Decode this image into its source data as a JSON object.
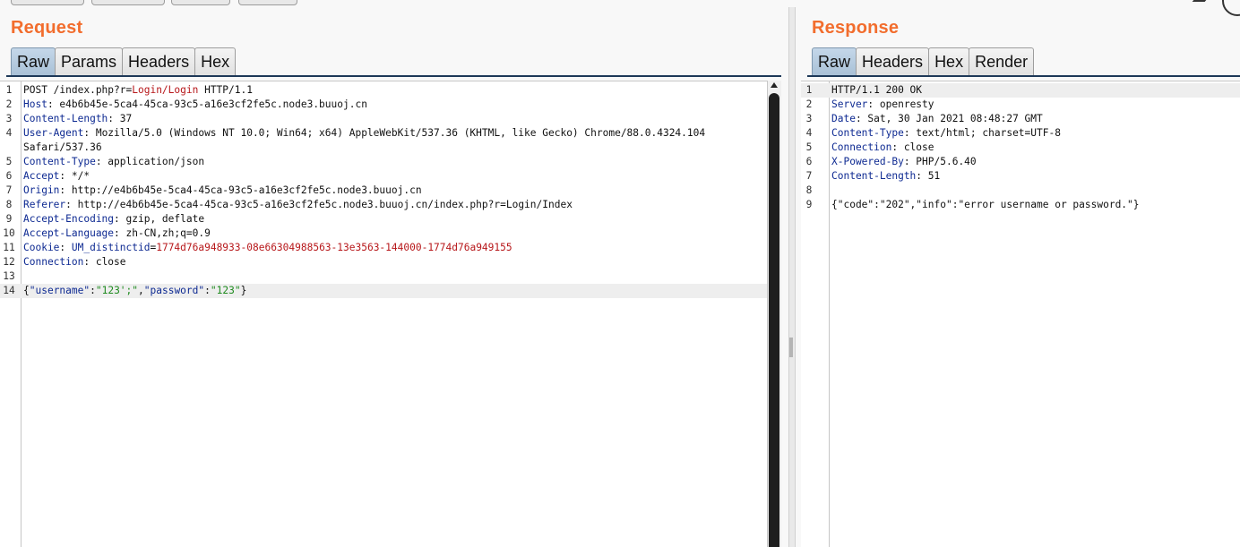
{
  "request": {
    "title": "Request",
    "tabs": [
      {
        "label": "Raw",
        "active": true
      },
      {
        "label": "Params",
        "active": false
      },
      {
        "label": "Headers",
        "active": false
      },
      {
        "label": "Hex",
        "active": false
      }
    ],
    "lines": [
      {
        "n": "1",
        "parts": [
          {
            "t": "POST /index.php?r="
          },
          {
            "t": "Login/Login",
            "c": "red"
          },
          {
            "t": " HTTP/1.1"
          }
        ]
      },
      {
        "n": "2",
        "parts": [
          {
            "t": "Host",
            "c": "hn"
          },
          {
            "t": ": e4b6b45e-5ca4-45ca-93c5-a16e3cf2fe5c.node3.buuoj.cn"
          }
        ]
      },
      {
        "n": "3",
        "parts": [
          {
            "t": "Content-Length",
            "c": "hn"
          },
          {
            "t": ": 37"
          }
        ]
      },
      {
        "n": "4",
        "parts": [
          {
            "t": "User-Agent",
            "c": "hn"
          },
          {
            "t": ": Mozilla/5.0 (Windows NT 10.0; Win64; x64) AppleWebKit/537.36 (KHTML, like Gecko) Chrome/88.0.4324.104"
          }
        ]
      },
      {
        "n": "",
        "parts": [
          {
            "t": "Safari/537.36"
          }
        ]
      },
      {
        "n": "5",
        "parts": [
          {
            "t": "Content-Type",
            "c": "hn"
          },
          {
            "t": ": application/json"
          }
        ]
      },
      {
        "n": "6",
        "parts": [
          {
            "t": "Accept",
            "c": "hn"
          },
          {
            "t": ": */*"
          }
        ]
      },
      {
        "n": "7",
        "parts": [
          {
            "t": "Origin",
            "c": "hn"
          },
          {
            "t": ": http://e4b6b45e-5ca4-45ca-93c5-a16e3cf2fe5c.node3.buuoj.cn"
          }
        ]
      },
      {
        "n": "8",
        "parts": [
          {
            "t": "Referer",
            "c": "hn"
          },
          {
            "t": ": http://e4b6b45e-5ca4-45ca-93c5-a16e3cf2fe5c.node3.buuoj.cn/index.php?r=Login/Index"
          }
        ]
      },
      {
        "n": "9",
        "parts": [
          {
            "t": "Accept-Encoding",
            "c": "hn"
          },
          {
            "t": ": gzip, deflate"
          }
        ]
      },
      {
        "n": "10",
        "parts": [
          {
            "t": "Accept-Language",
            "c": "hn"
          },
          {
            "t": ": zh-CN,zh;q=0.9"
          }
        ]
      },
      {
        "n": "11",
        "parts": [
          {
            "t": "Cookie",
            "c": "hn"
          },
          {
            "t": ": "
          },
          {
            "t": "UM_distinctid",
            "c": "hn"
          },
          {
            "t": "="
          },
          {
            "t": "1774d76a948933-08e66304988563-13e3563-144000-1774d76a949155",
            "c": "red"
          }
        ]
      },
      {
        "n": "12",
        "parts": [
          {
            "t": "Connection",
            "c": "hn"
          },
          {
            "t": ": close"
          }
        ]
      },
      {
        "n": "13",
        "parts": []
      },
      {
        "n": "14",
        "hl": true,
        "parts": [
          {
            "t": "{"
          },
          {
            "t": "\"username\"",
            "c": "hn"
          },
          {
            "t": ":"
          },
          {
            "t": "\"123';\"",
            "c": "grn"
          },
          {
            "t": ","
          },
          {
            "t": "\"password\"",
            "c": "hn"
          },
          {
            "t": ":"
          },
          {
            "t": "\"123\"",
            "c": "grn"
          },
          {
            "t": "}"
          }
        ]
      }
    ]
  },
  "response": {
    "title": "Response",
    "tabs": [
      {
        "label": "Raw",
        "active": true
      },
      {
        "label": "Headers",
        "active": false
      },
      {
        "label": "Hex",
        "active": false
      },
      {
        "label": "Render",
        "active": false
      }
    ],
    "lines": [
      {
        "n": "1",
        "hl": true,
        "parts": [
          {
            "t": "HTTP/1.1 200 OK"
          }
        ]
      },
      {
        "n": "2",
        "parts": [
          {
            "t": "Server",
            "c": "hn"
          },
          {
            "t": ": openresty"
          }
        ]
      },
      {
        "n": "3",
        "parts": [
          {
            "t": "Date",
            "c": "hn"
          },
          {
            "t": ": Sat, 30 Jan 2021 08:48:27 GMT"
          }
        ]
      },
      {
        "n": "4",
        "parts": [
          {
            "t": "Content-Type",
            "c": "hn"
          },
          {
            "t": ": text/html; charset=UTF-8"
          }
        ]
      },
      {
        "n": "5",
        "parts": [
          {
            "t": "Connection",
            "c": "hn"
          },
          {
            "t": ": close"
          }
        ]
      },
      {
        "n": "6",
        "parts": [
          {
            "t": "X-Powered-By",
            "c": "hn"
          },
          {
            "t": ": PHP/5.6.40"
          }
        ]
      },
      {
        "n": "7",
        "parts": [
          {
            "t": "Content-Length",
            "c": "hn"
          },
          {
            "t": ": 51"
          }
        ]
      },
      {
        "n": "8",
        "parts": []
      },
      {
        "n": "9",
        "parts": [
          {
            "t": "{\"code\":\"202\",\"info\":\"error username or password.\"}"
          }
        ]
      }
    ]
  },
  "colors": {
    "title": "#f26d2d",
    "header_name": "#0e2a92",
    "value_red": "#b7171a",
    "value_green": "#1e8a1e"
  }
}
